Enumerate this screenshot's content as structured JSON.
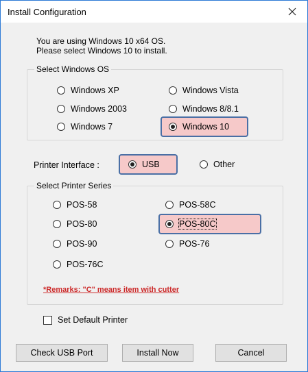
{
  "window": {
    "title": "Install Configuration",
    "close_label": "×"
  },
  "intro": {
    "line1": "You are using Windows 10 x64 OS.",
    "line2": "Please select Windows 10 to install."
  },
  "os_group": {
    "legend": "Select Windows OS",
    "options": [
      {
        "label": "Windows XP",
        "selected": false
      },
      {
        "label": "Windows Vista",
        "selected": false
      },
      {
        "label": "Windows 2003",
        "selected": false
      },
      {
        "label": "Windows 8/8.1",
        "selected": false
      },
      {
        "label": "Windows 7",
        "selected": false
      },
      {
        "label": "Windows 10",
        "selected": true
      }
    ]
  },
  "interface": {
    "label": "Printer Interface :",
    "options": [
      {
        "label": "USB",
        "selected": true
      },
      {
        "label": "Other",
        "selected": false
      }
    ]
  },
  "printer_group": {
    "legend": "Select Printer Series",
    "options": [
      {
        "label": "POS-58",
        "selected": false
      },
      {
        "label": "POS-58C",
        "selected": false
      },
      {
        "label": "POS-80",
        "selected": false
      },
      {
        "label": "POS-80C",
        "selected": true
      },
      {
        "label": "POS-90",
        "selected": false
      },
      {
        "label": "POS-76",
        "selected": false
      },
      {
        "label": "POS-76C",
        "selected": false
      }
    ],
    "remarks": "*Remarks: \"C\" means item with cutter"
  },
  "default_printer": {
    "label": "Set Default Printer",
    "checked": false
  },
  "buttons": {
    "check_usb": "Check USB Port",
    "install": "Install Now",
    "cancel": "Cancel"
  },
  "colors": {
    "highlight_fill": "#f6c9c9",
    "highlight_border": "#4a6fa5",
    "remarks": "#cc2a2a"
  }
}
